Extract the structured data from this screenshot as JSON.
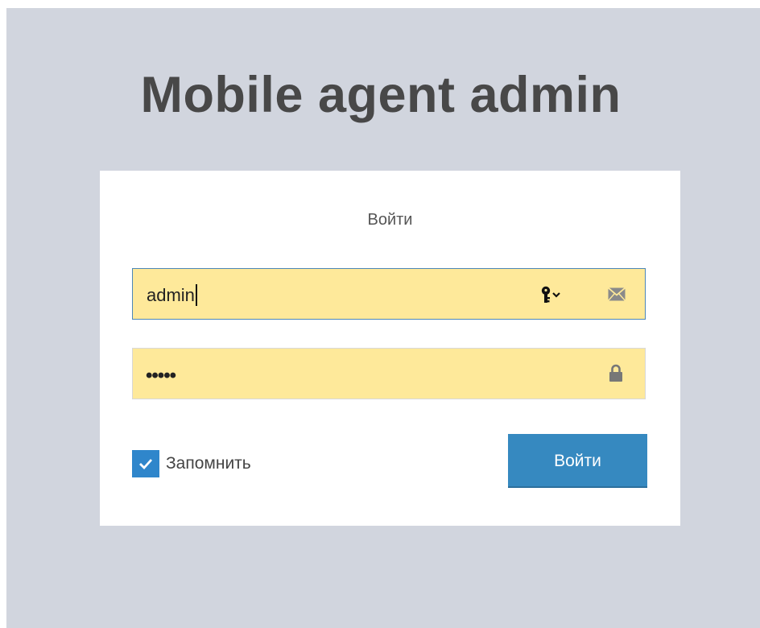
{
  "app": {
    "title": "Mobile agent admin"
  },
  "login_form": {
    "heading": "Войти",
    "username": {
      "value": "admin",
      "icon": "envelope-icon",
      "autofill_icon": "key-icon"
    },
    "password": {
      "masked_value": "•••••",
      "icon": "lock-icon"
    },
    "remember": {
      "label": "Запомнить",
      "checked": true
    },
    "submit_label": "Войти"
  },
  "colors": {
    "background": "#d1d5de",
    "card": "#ffffff",
    "input_autofill": "#fee99a",
    "input_focus_border": "#4c87b8",
    "primary": "#3689c0",
    "checkbox": "#2f86cb",
    "title_text": "#484848"
  }
}
